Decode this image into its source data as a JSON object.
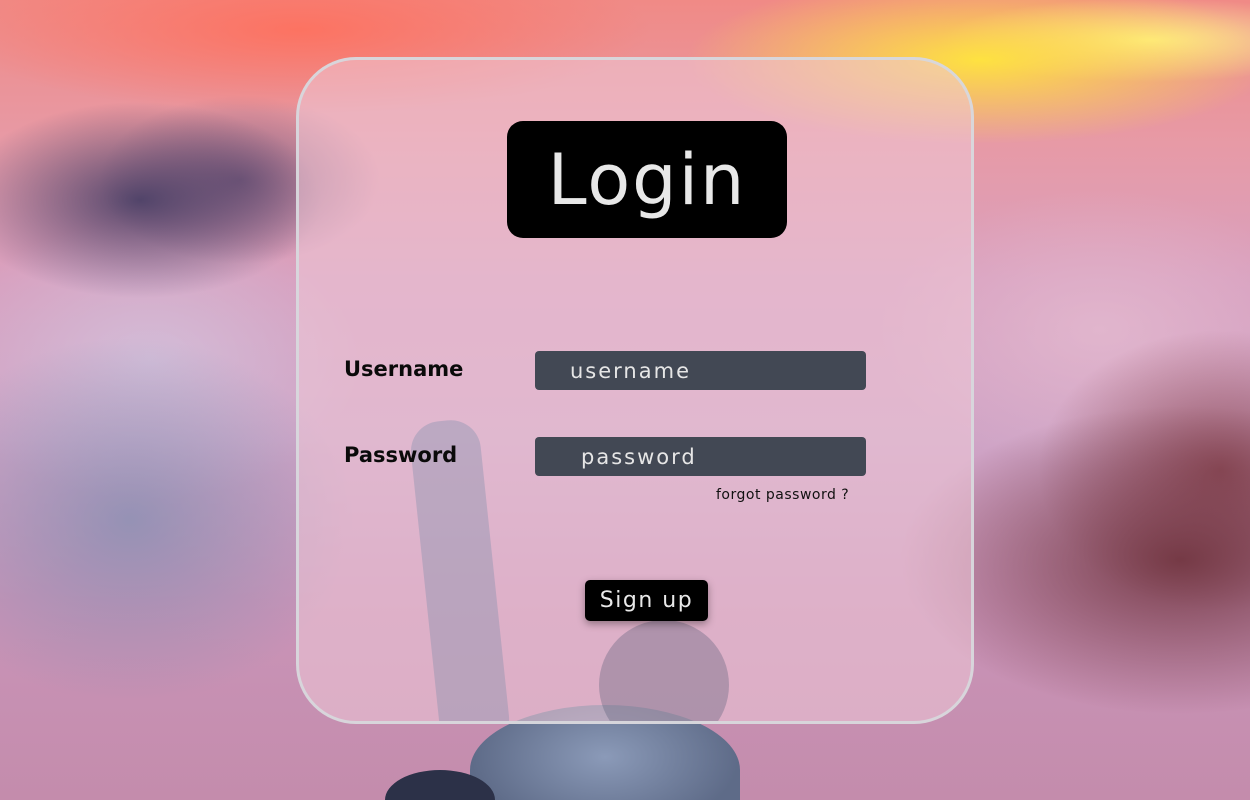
{
  "login": {
    "title": "Login",
    "username_label": "Username",
    "username_placeholder": "username",
    "password_label": "Password",
    "password_placeholder": "password",
    "forgot_link": "forgot password ?",
    "signup_button": "Sign up"
  },
  "colors": {
    "title_box": "#000000",
    "input_background": "#424854",
    "button_background": "#000000",
    "card_border": "#d7d7dc"
  }
}
